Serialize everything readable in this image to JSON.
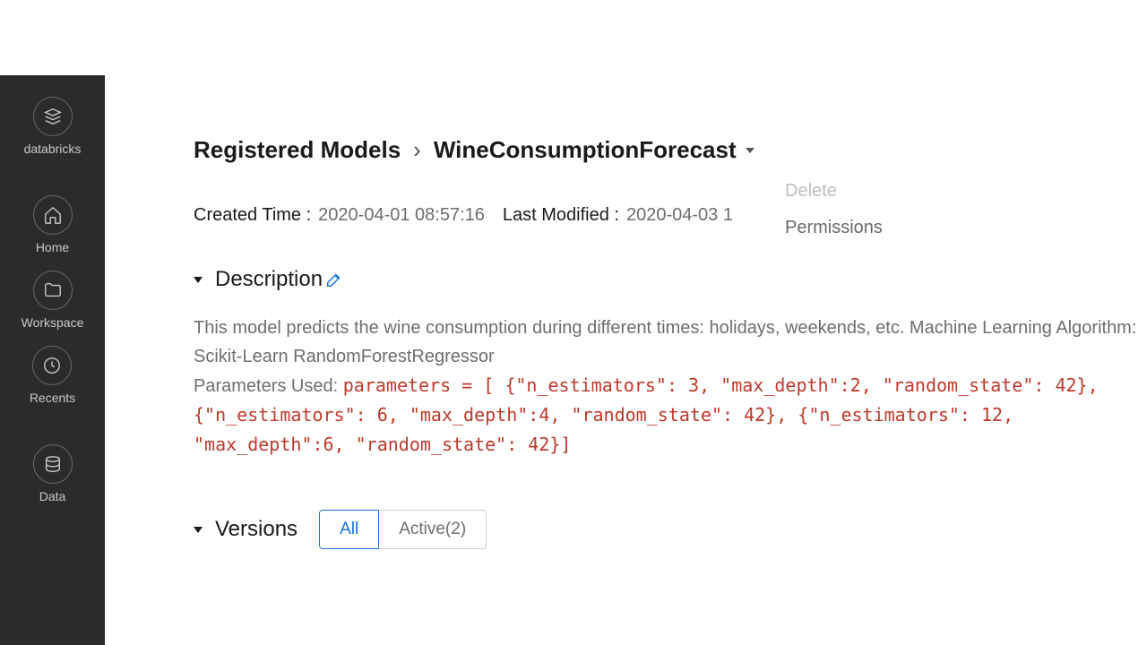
{
  "sidebar": {
    "brand": "databricks",
    "items": [
      {
        "label": "Home"
      },
      {
        "label": "Workspace"
      },
      {
        "label": "Recents"
      },
      {
        "label": "Data"
      }
    ]
  },
  "breadcrumb": {
    "root": "Registered Models",
    "current": "WineConsumptionForecast"
  },
  "meta": {
    "created_label": "Created Time :",
    "created_value": "2020-04-01 08:57:16",
    "modified_label": "Last Modified :",
    "modified_value": "2020-04-03 1"
  },
  "context_menu": {
    "delete": "Delete",
    "permissions": "Permissions"
  },
  "description": {
    "title": "Description",
    "body_prefix": "This model predicts the wine consumption during different times: holidays, weekends, etc. Machine Learning Algorithm: Scikit-Learn RandomForestRegressor",
    "params_label": "Parameters Used: ",
    "params_code": "parameters = [ {\"n_estimators\": 3, \"max_depth\":2, \"random_state\": 42}, {\"n_estimators\": 6, \"max_depth\":4, \"random_state\": 42}, {\"n_estimators\": 12, \"max_depth\":6, \"random_state\": 42}]"
  },
  "versions": {
    "title": "Versions",
    "all": "All",
    "active": "Active(2)"
  }
}
